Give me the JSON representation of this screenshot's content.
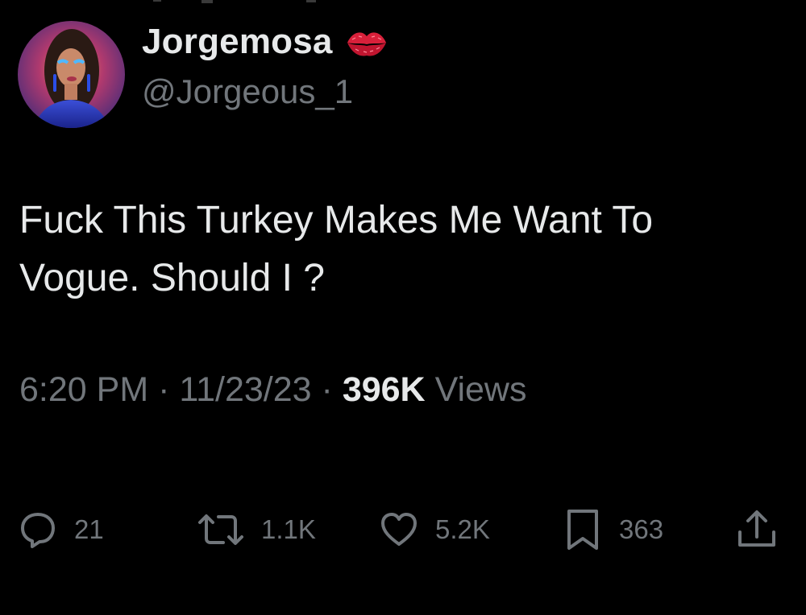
{
  "author": {
    "display_name": "Jorgemosa",
    "handle": "@Jorgeous_1",
    "name_emoji": "kiss-mark-icon"
  },
  "tweet": {
    "text_line1": "Fuck This Turkey Makes Me Want To",
    "text_line2": "Vogue. Should I ?"
  },
  "meta": {
    "time": "6:20 PM",
    "separator": "·",
    "date": "11/23/23",
    "views_count": "396K",
    "views_label": "Views"
  },
  "actions": {
    "replies": "21",
    "retweets": "1.1K",
    "likes": "5.2K",
    "bookmarks": "363"
  },
  "colors": {
    "background": "#000000",
    "primary_text": "#e7e9ea",
    "secondary_text": "#71767b",
    "lips": "#d8203a"
  }
}
